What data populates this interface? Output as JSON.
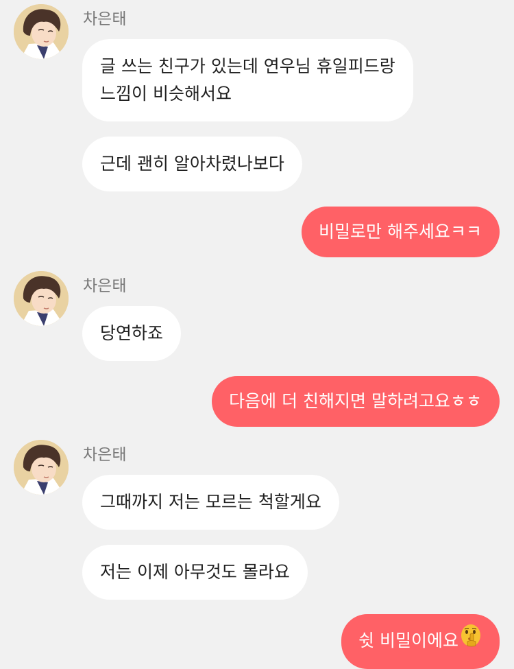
{
  "theme": {
    "background": "#f1f1f1",
    "incoming_bubble": "#ffffff",
    "outgoing_bubble": "#ff6166",
    "outgoing_text": "#ffffff",
    "incoming_text": "#1f1f1f",
    "sender_name_color": "#777777"
  },
  "messages": {
    "group1": {
      "sender": "차은태",
      "avatar_icon": "profile-avatar-icon",
      "m1_line1": "글 쓰는 친구가 있는데 연우님 휴일피드랑",
      "m1_line2": "느낌이 비슷해서요",
      "m2": "근데 괜히 알아차렸나보다"
    },
    "out1": "비밀로만 해주세요ㅋㅋ",
    "group2": {
      "sender": "차은태",
      "avatar_icon": "profile-avatar-icon",
      "m1": "당연하죠"
    },
    "out2": "다음에 더 친해지면 말하려고요ㅎㅎ",
    "group3": {
      "sender": "차은태",
      "avatar_icon": "profile-avatar-icon",
      "m1": "그때까지 저는 모르는 척할게요",
      "m2": "저는 이제 아무것도 몰라요"
    },
    "out3": {
      "text": "쉿 비밀이에요",
      "emoji_icon": "shushing-face-emoji-icon"
    }
  }
}
